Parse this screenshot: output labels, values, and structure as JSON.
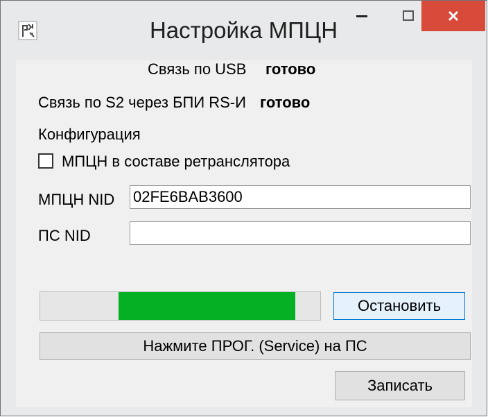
{
  "window": {
    "title": "Настройка МПЦН",
    "icons": {
      "app": "app-icon",
      "minimize": "minimize-icon",
      "maximize": "maximize-icon",
      "close": "close-icon"
    },
    "colors": {
      "close_button": "#d84a3a",
      "progress_fill": "#06b025"
    }
  },
  "status": {
    "usb_label": "Связь по USB",
    "usb_value": "готово",
    "s2_label": "Связь по S2 через БПИ RS-И",
    "s2_value": "готово"
  },
  "config": {
    "section_label": "Конфигурация",
    "repeater_checkbox_label": "МПЦН в составе ретранслятора",
    "repeater_checked": false,
    "mpcn_nid_label": "МПЦН NID",
    "mpcn_nid_value": "02FE6BAB3600",
    "ps_nid_label": "ПС NID",
    "ps_nid_value": ""
  },
  "progress": {
    "state": "marquee",
    "fill_start": 0.28,
    "fill_end": 0.91
  },
  "buttons": {
    "stop": "Остановить",
    "prompt": "Нажмите ПРОГ. (Service) на ПС",
    "write": "Записать"
  }
}
